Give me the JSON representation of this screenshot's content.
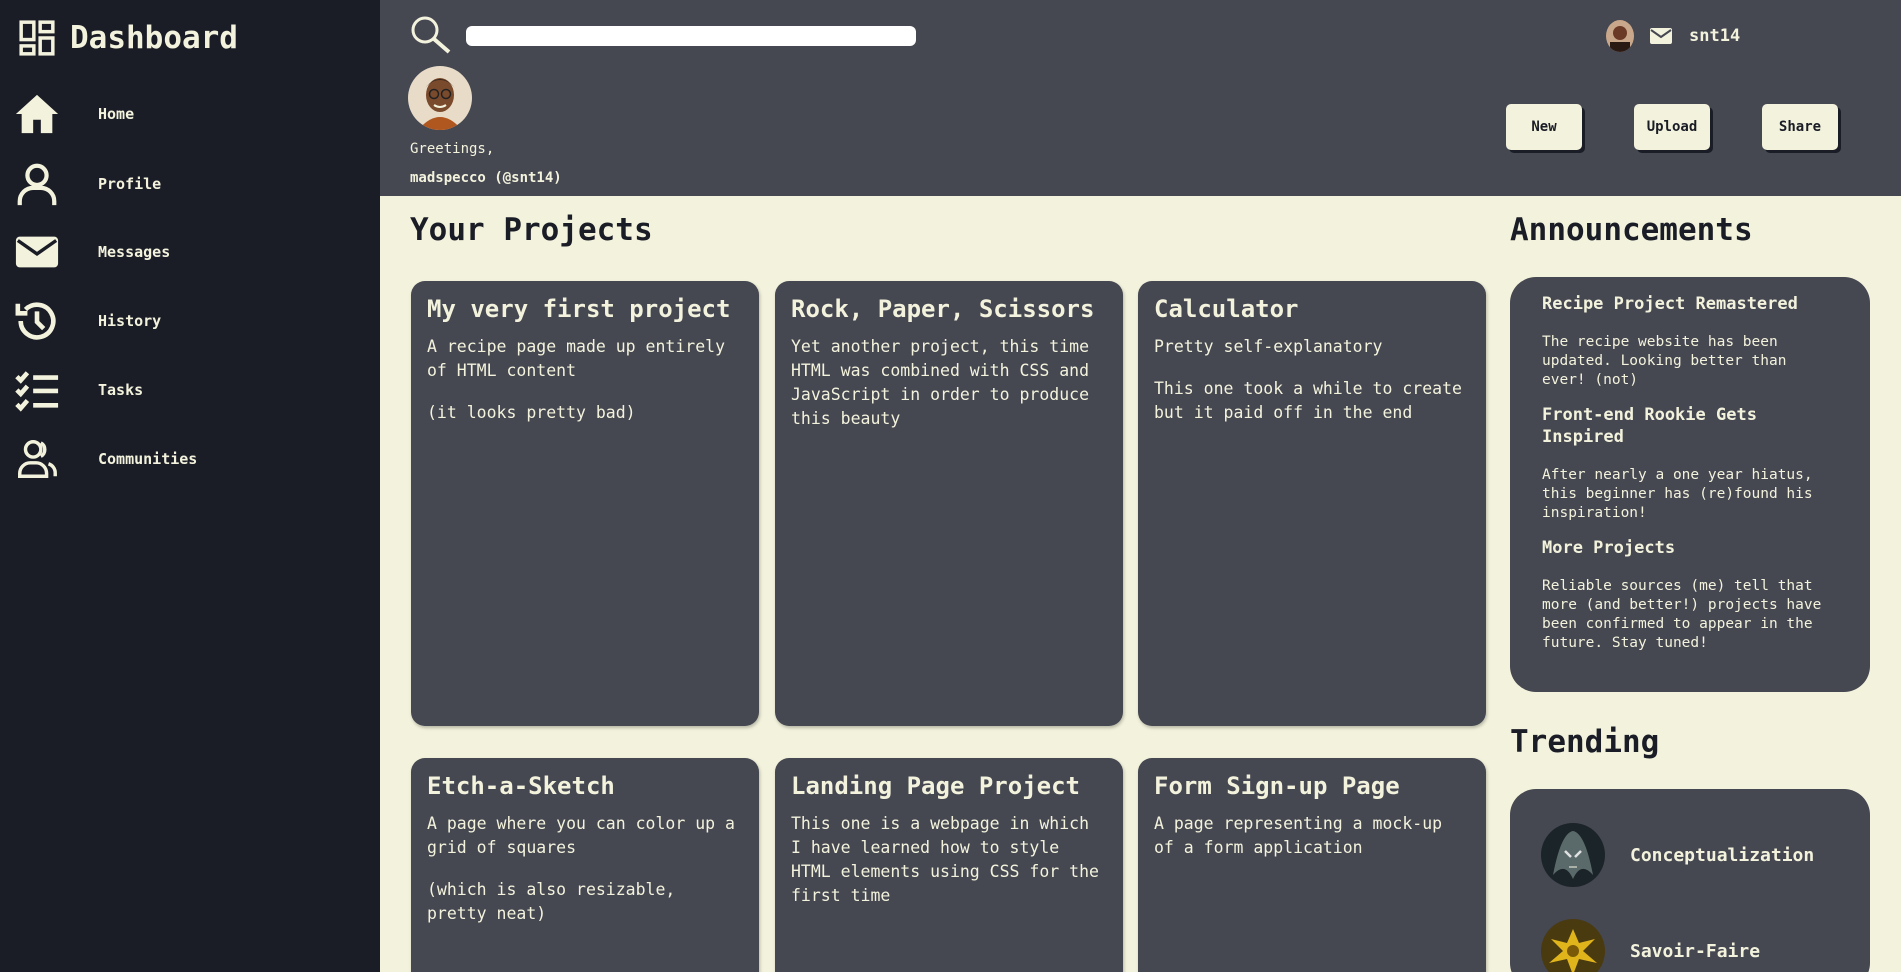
{
  "sidebar": {
    "title": "Dashboard",
    "items": [
      {
        "label": "Home",
        "icon": "home-icon"
      },
      {
        "label": "Profile",
        "icon": "user-icon"
      },
      {
        "label": "Messages",
        "icon": "mail-icon"
      },
      {
        "label": "History",
        "icon": "history-icon"
      },
      {
        "label": "Tasks",
        "icon": "tasks-icon"
      },
      {
        "label": "Communities",
        "icon": "communities-icon"
      }
    ]
  },
  "header": {
    "search_placeholder": "",
    "username": "snt14",
    "greeting": "Greetings,",
    "handle": "madspecco (@snt14)",
    "buttons": [
      "New",
      "Upload",
      "Share"
    ]
  },
  "projects": {
    "title": "Your Projects",
    "cards": [
      {
        "title": "My very first project",
        "paragraphs": [
          "A recipe page made up entirely of HTML content",
          "(it looks pretty bad)"
        ]
      },
      {
        "title": "Rock, Paper, Scissors",
        "paragraphs": [
          "Yet another project, this time HTML was combined with CSS and JavaScript in order to produce this beauty"
        ]
      },
      {
        "title": "Calculator",
        "paragraphs": [
          "Pretty self-explanatory",
          "This one took a while to create but it paid off in the end"
        ]
      },
      {
        "title": "Etch-a-Sketch",
        "paragraphs": [
          "A page where you can color up a grid of squares",
          "(which is also resizable, pretty neat)"
        ]
      },
      {
        "title": "Landing Page Project",
        "paragraphs": [
          "This one is a webpage in which I have learned how to style HTML elements using CSS for the first time"
        ]
      },
      {
        "title": "Form Sign-up Page",
        "paragraphs": [
          "A page representing a mock-up of a form application"
        ]
      }
    ]
  },
  "announcements": {
    "title": "Announcements",
    "items": [
      {
        "title": "Recipe Project Remastered",
        "body": "The recipe website has been updated. Looking better than ever! (not)"
      },
      {
        "title": "Front-end Rookie Gets Inspired",
        "body": "After nearly a one year hiatus, this beginner has (re)found his inspiration!"
      },
      {
        "title": "More Projects",
        "body": "Reliable sources (me) tell that more (and better!) projects have been confirmed to appear in the future. Stay tuned!"
      }
    ]
  },
  "trending": {
    "title": "Trending",
    "items": [
      {
        "name": "Conceptualization"
      },
      {
        "name": "Savoir-Faire"
      }
    ]
  },
  "colors": {
    "sidebar_bg": "#1a1c26",
    "panel_bg": "#454751",
    "cream": "#f3f3dd"
  }
}
